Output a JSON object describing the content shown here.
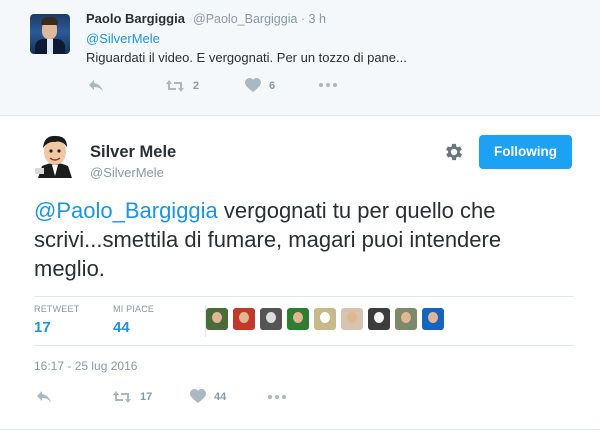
{
  "parent_tweet": {
    "name": "Paolo Bargiggia",
    "handle": "@Paolo_Bargiggia",
    "time": "· 3 h",
    "reply_to": "@SilverMele",
    "text": "Riguardati il video. E vergognati. Per un tozzo di pane...",
    "retweets": "2",
    "likes": "6"
  },
  "main_tweet": {
    "name": "Silver Mele",
    "handle": "@SilverMele",
    "follow_label": "Following",
    "mention": "@Paolo_Bargiggia",
    "text": " vergognati tu per quello che scrivi...smettila di fumare, magari puoi intendere meglio.",
    "stats": {
      "retweet_label": "RETWEET",
      "retweet_count": "17",
      "like_label": "MI PIACE",
      "like_count": "44"
    },
    "timestamp": "16:17 - 25 lug 2016",
    "actions": {
      "retweets": "17",
      "likes": "44"
    }
  },
  "colors": {
    "accent": "#1b95e0",
    "button": "#1da1f2",
    "muted": "#8899a6"
  },
  "icons": [
    "reply-icon",
    "retweet-icon",
    "heart-icon",
    "more-icon",
    "gear-icon"
  ]
}
